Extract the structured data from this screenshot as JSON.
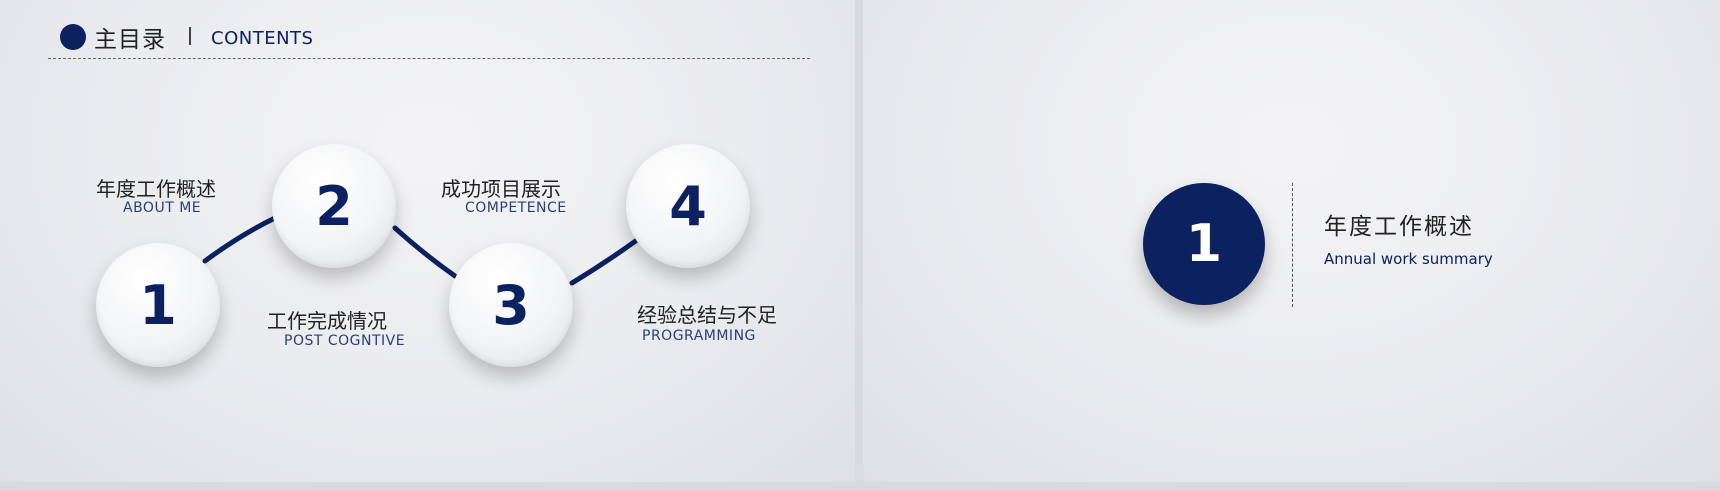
{
  "colors": {
    "accent": "#0b2160",
    "background": "#eaebee"
  },
  "left_slide": {
    "header": {
      "title": "主目录",
      "subtitle": "CONTENTS"
    },
    "steps": [
      {
        "number": "1",
        "title_zh": "年度工作概述",
        "title_en": "ABOUT ME"
      },
      {
        "number": "2",
        "title_zh": "工作完成情况",
        "title_en": "POST COGNTIVE"
      },
      {
        "number": "3",
        "title_zh": "成功项目展示",
        "title_en": "COMPETENCE"
      },
      {
        "number": "4",
        "title_zh": "经验总结与不足",
        "title_en": "PROGRAMMING"
      }
    ]
  },
  "right_slide": {
    "number": "1",
    "title": "年度工作概述",
    "subtitle": "Annual work summary"
  }
}
